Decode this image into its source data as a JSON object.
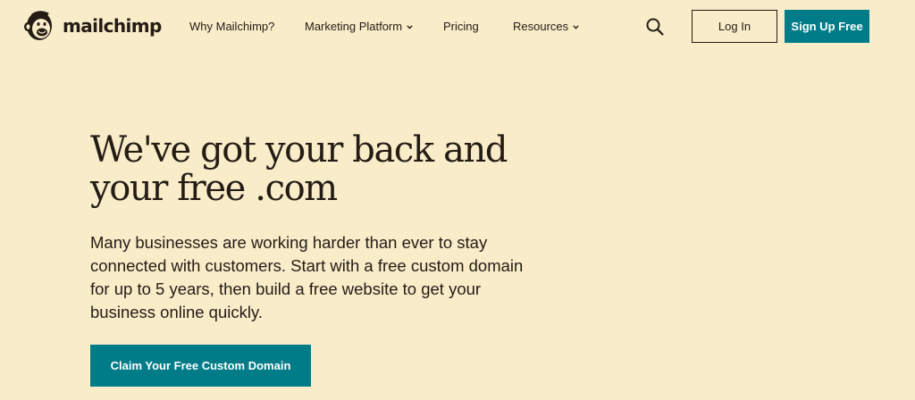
{
  "brand": {
    "name": "mailchimp",
    "logo_icon": "freddie-monkey-icon"
  },
  "nav": {
    "items": [
      {
        "label": "Why Mailchimp?",
        "has_dropdown": false
      },
      {
        "label": "Marketing Platform",
        "has_dropdown": true
      },
      {
        "label": "Pricing",
        "has_dropdown": false
      },
      {
        "label": "Resources",
        "has_dropdown": true
      }
    ],
    "search_icon": "search-icon",
    "login_label": "Log In",
    "signup_label": "Sign Up Free"
  },
  "hero": {
    "headline_lines": [
      "We've got your back and",
      "your free .com"
    ],
    "body_lines": [
      "Many businesses are working harder than ever to stay",
      "connected with customers. Start with a free custom domain",
      "for up to 5 years, then build a free website to get your",
      "business online quickly."
    ],
    "cta_label": "Claim Your Free Custom Domain"
  },
  "colors": {
    "background": "#f9ecc9",
    "text": "#241c15",
    "accent": "#007c89",
    "button_text": "#ffffff"
  }
}
